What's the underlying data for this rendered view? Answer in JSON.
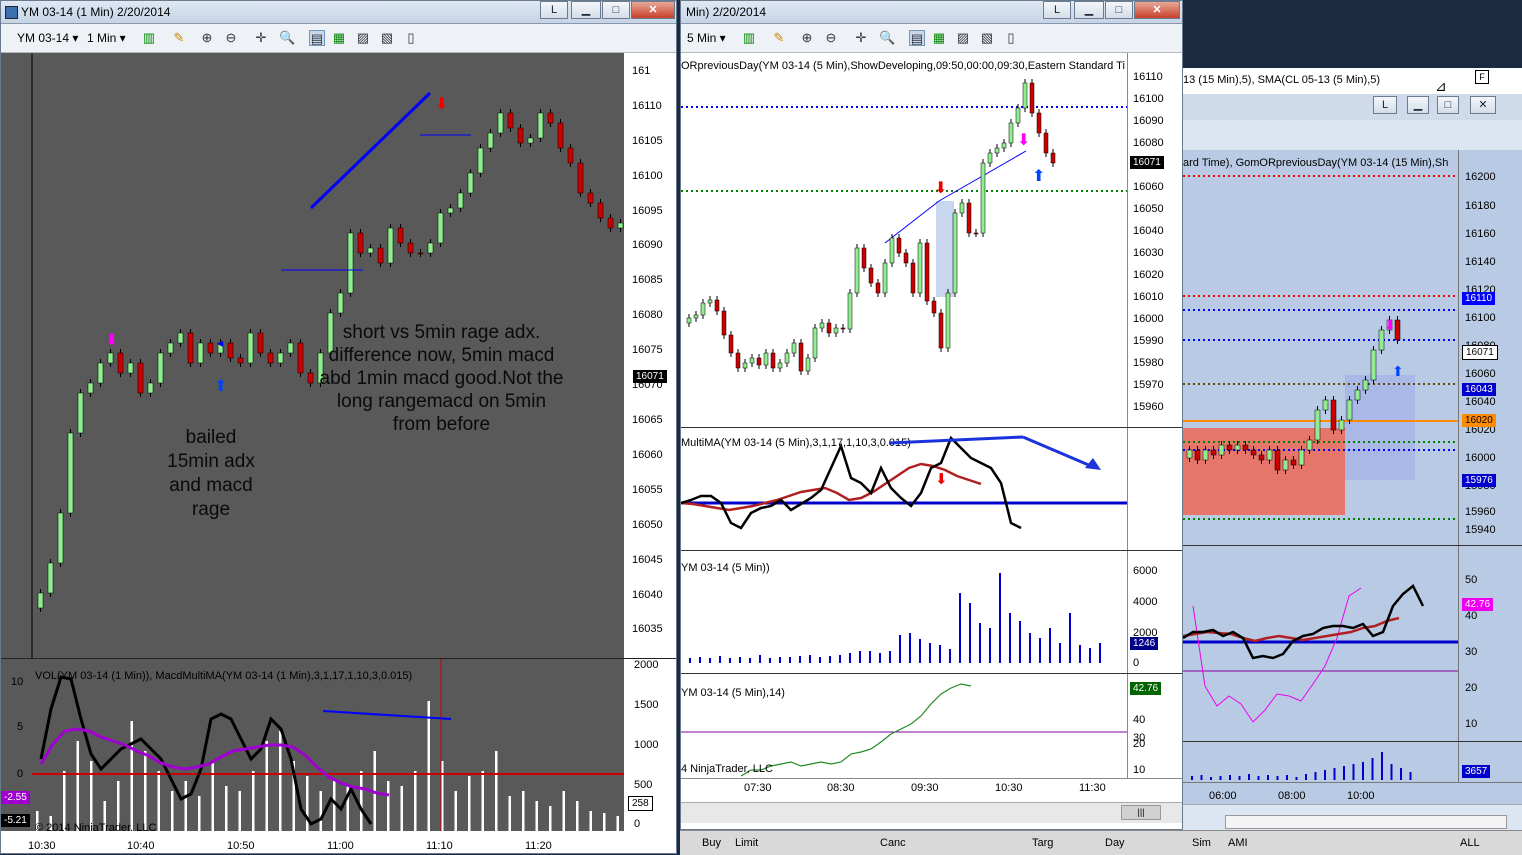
{
  "win1": {
    "title": "YM 03-14 (1 Min)  2/20/2014",
    "instrument": "YM 03-14",
    "interval": "1 Min",
    "price_ticks": [
      "161",
      "16110",
      "16105",
      "16100",
      "16095",
      "16090",
      "16085",
      "16080",
      "16075",
      "16070",
      "16065",
      "16060",
      "16055",
      "16050",
      "16045",
      "16040",
      "16035"
    ],
    "last_price": "16071",
    "annotation_right": [
      "short vs  5min rage adx.",
      "difference now, 5min macd",
      "abd 1min macd good.Not the",
      "long rangemacd on 5min",
      "from before"
    ],
    "annotation_left": [
      "bailed",
      "15min adx",
      "and macd",
      "rage"
    ],
    "indicator_label": "VOL(YM 03-14 (1 Min)), MacdMultiMA(YM 03-14 (1 Min),3,1,17,1,10,3,0.015)",
    "lower_left_ticks": [
      "10",
      "5",
      "0",
      "-2.55",
      "-5.21"
    ],
    "lower_right_ticks": [
      "2000",
      "1500",
      "1000",
      "500",
      "258",
      "0"
    ],
    "time_ticks": [
      "10:30",
      "10:40",
      "10:50",
      "11:00",
      "11:10",
      "11:20"
    ],
    "copyright": "© 2014 NinjaTrader, LLC"
  },
  "win2": {
    "title": "Min)  2/20/2014",
    "interval": "5 Min",
    "indicator_top": "ORpreviousDay(YM 03-14 (5 Min),ShowDeveloping,09:50,00:00,09:30,Eastern Standard Ti",
    "price_ticks": [
      "16110",
      "16100",
      "16090",
      "16080",
      "16070",
      "16060",
      "16050",
      "16040",
      "16030",
      "16020",
      "16010",
      "16000",
      "15990",
      "15980",
      "15970",
      "15960"
    ],
    "last_price": "16071",
    "macd_label": "MultiMA(YM 03-14 (5 Min),3,1,17,1,10,3,0.015)",
    "vol_label": "YM 03-14 (5 Min))",
    "vol_ticks": [
      "6000",
      "4000",
      "2000",
      "0"
    ],
    "vol_last": "1246",
    "adx_label": "YM 03-14 (5 Min),14)",
    "adx_ticks": [
      "40",
      "30",
      "20",
      "10"
    ],
    "adx_last": "42.76",
    "copyright": "4 NinjaTrader, LLC",
    "time_ticks": [
      "07:30",
      "08:30",
      "09:30",
      "10:30",
      "11:30"
    ]
  },
  "win3": {
    "header": "13 (15 Min),5), SMA(CL 05-13 (5 Min),5)",
    "indicator_top": "ard Time), GomORpreviousDay(YM 03-14 (15 Min),Sh",
    "price_ticks": [
      "16200",
      "16180",
      "16160",
      "16140",
      "16120",
      "16100",
      "16080",
      "16060",
      "16040",
      "16020",
      "16000",
      "15980",
      "15960",
      "15940"
    ],
    "price_boxes": [
      "16110",
      "16071",
      "16043",
      "16020",
      "15976"
    ],
    "mid_ticks": [
      "50",
      "40",
      "30",
      "20",
      "10"
    ],
    "mid_box": "42.76",
    "vol_box": "3657",
    "time_ticks": [
      "06:00",
      "08:00",
      "10:00"
    ]
  },
  "bottom_strip": [
    "Buy",
    "Limit",
    "Canc",
    "Targ",
    "Day",
    "Sim",
    "AMI",
    "ALL"
  ],
  "colors": {
    "bg_dark": "#595959",
    "bg_blue": "#b9cbe4",
    "up_candle": "#90ee90",
    "down_candle": "#cc0000"
  }
}
